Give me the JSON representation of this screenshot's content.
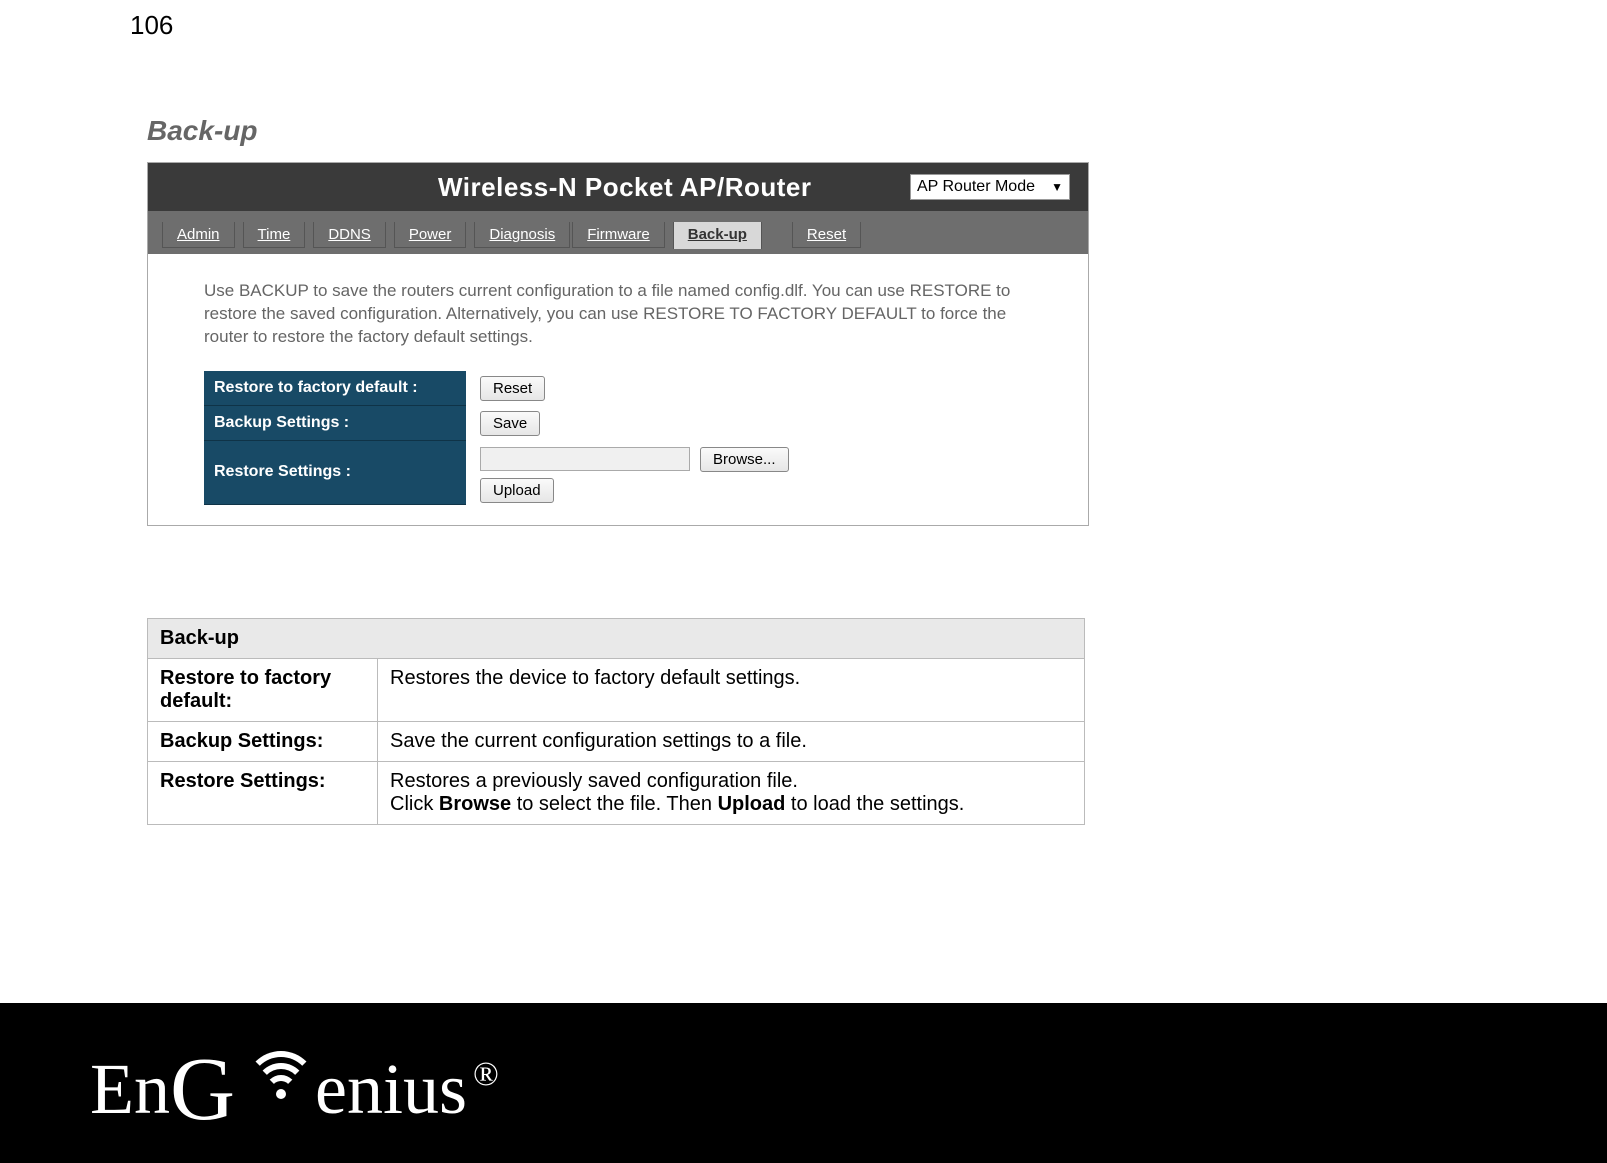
{
  "page_number": "106",
  "section_title": "Back-up",
  "router": {
    "title": "Wireless-N Pocket AP/Router",
    "mode_selected": "AP Router Mode",
    "tabs": [
      "Admin",
      "Time",
      "DDNS",
      "Power",
      "Diagnosis",
      "Firmware",
      "Back-up",
      "Reset"
    ],
    "active_tab": "Back-up",
    "description": "Use BACKUP to save the routers current configuration to a file named config.dlf. You can use RESTORE to restore the saved configuration. Alternatively, you can use RESTORE TO FACTORY DEFAULT to force the router to restore the factory default settings.",
    "rows": {
      "factory_label": "Restore to factory default :",
      "factory_button": "Reset",
      "backup_label": "Backup Settings :",
      "backup_button": "Save",
      "restore_label": "Restore Settings :",
      "browse_button": "Browse...",
      "upload_button": "Upload"
    }
  },
  "explain": {
    "header": "Back-up",
    "r1_label": "Restore to factory default:",
    "r1_text": "Restores the device to factory default settings.",
    "r2_label": "Backup Settings:",
    "r2_text": "Save the current configuration settings to a file.",
    "r3_label": "Restore Settings:",
    "r3_line1": "Restores a previously saved configuration file.",
    "r3_click": "Click ",
    "r3_browse": "Browse",
    "r3_mid": " to select the file. Then ",
    "r3_upload": "Upload",
    "r3_end": " to load the settings."
  },
  "footer": {
    "logo_en": "En",
    "logo_g": "G",
    "logo_rest": "enius",
    "logo_r": "®"
  }
}
